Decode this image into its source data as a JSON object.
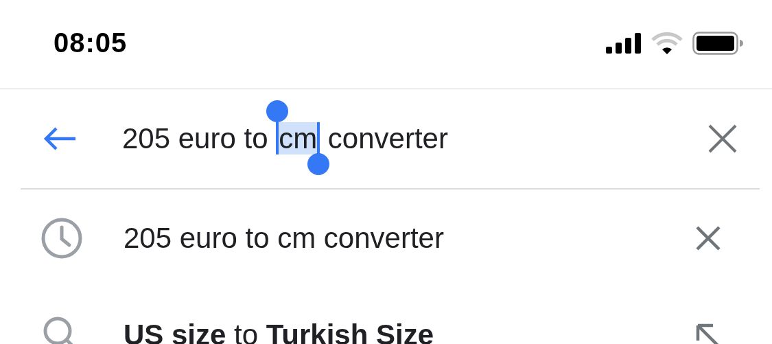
{
  "status_bar": {
    "time": "08:05"
  },
  "search": {
    "segments": [
      {
        "text": "205 euro to ",
        "selected": false
      },
      {
        "text": "cm",
        "selected": true
      },
      {
        "text": " converter",
        "selected": false
      }
    ]
  },
  "suggestions": [
    {
      "kind": "history",
      "text": "205 euro to cm converter"
    },
    {
      "kind": "search",
      "text": "**US size** to **Turkish Size**"
    }
  ]
}
